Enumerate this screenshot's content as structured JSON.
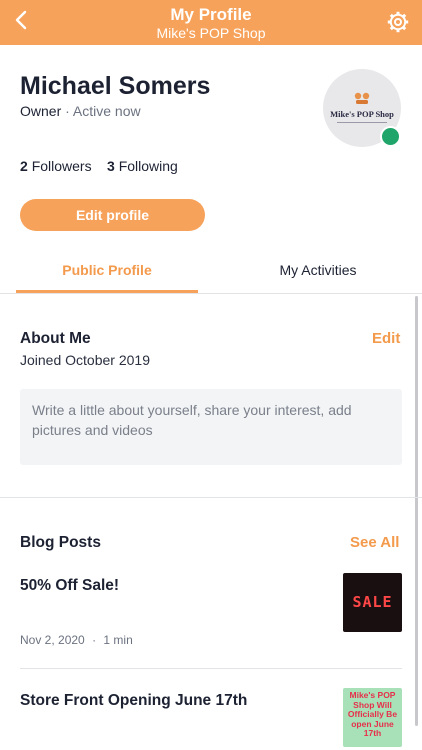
{
  "header": {
    "title": "My Profile",
    "subtitle": "Mike's POP Shop",
    "back_icon": "chevron-left-icon",
    "settings_icon": "gear-icon",
    "background_color": "#f7a25a"
  },
  "profile": {
    "name": "Michael Somers",
    "role": "Owner",
    "separator": "·",
    "status": "Active now",
    "avatar_logo_text": "Mike's POP Shop",
    "status_color": "#1fa56a",
    "followers_count": "2",
    "followers_label": "Followers",
    "following_count": "3",
    "following_label": "Following",
    "edit_button_label": "Edit profile"
  },
  "tabs": [
    {
      "label": "Public Profile",
      "active": true
    },
    {
      "label": "My Activities",
      "active": false
    }
  ],
  "about": {
    "title": "About Me",
    "edit_label": "Edit",
    "joined": "Joined October 2019",
    "placeholder": "Write a little about yourself, share your interest, add pictures and videos"
  },
  "blog": {
    "title": "Blog Posts",
    "see_all_label": "See All",
    "posts": [
      {
        "title": "50% Off Sale!",
        "date": "Nov 2, 2020",
        "separator": "·",
        "read_time": "1 min",
        "thumbnail_text": "SALE"
      },
      {
        "title": "Store Front Opening June 17th",
        "thumbnail_text": "Mike's POP Shop Will Officially Be open June 17th"
      }
    ]
  },
  "colors": {
    "accent": "#f7a25a",
    "accent_text": "#f39a4c",
    "text_primary": "#1d2233",
    "text_secondary": "#6b7280"
  }
}
